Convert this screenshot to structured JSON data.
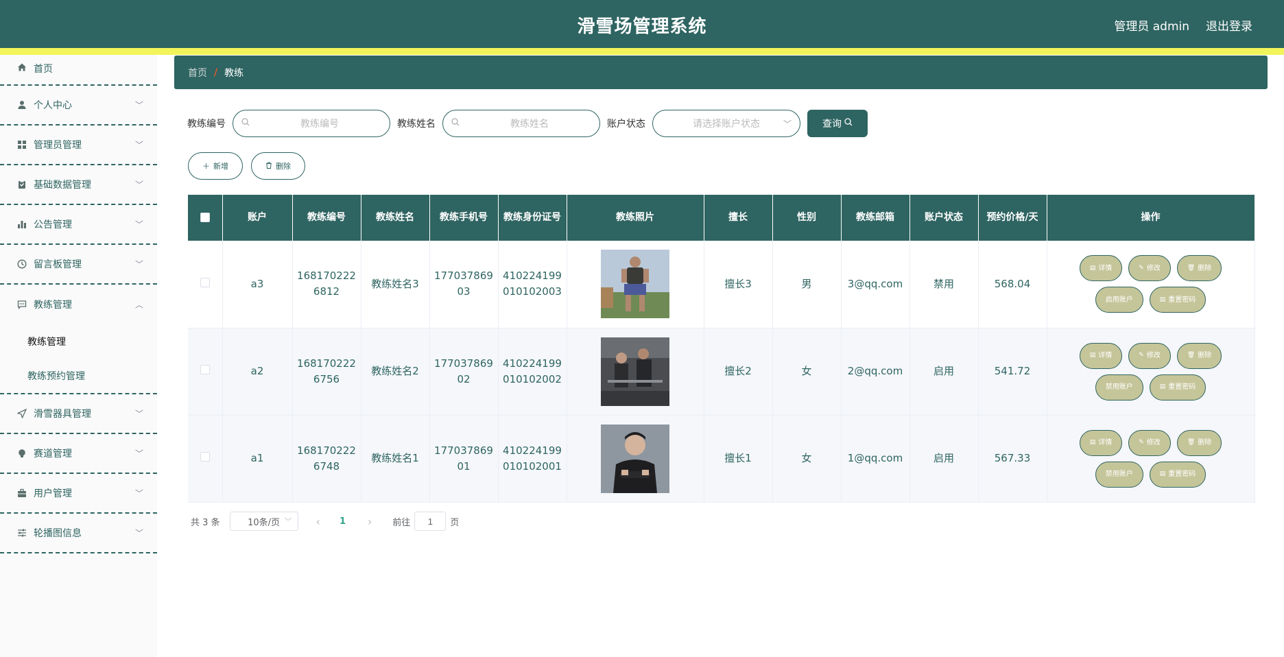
{
  "header": {
    "title": "滑雪场管理系统",
    "user_label": "管理员 admin",
    "logout_label": "退出登录"
  },
  "sidebar": {
    "items": [
      {
        "label": "首页",
        "icon": "home-icon"
      },
      {
        "label": "个人中心",
        "icon": "user-icon"
      },
      {
        "label": "管理员管理",
        "icon": "grid-icon"
      },
      {
        "label": "基础数据管理",
        "icon": "clipboard-icon"
      },
      {
        "label": "公告管理",
        "icon": "bar-chart-icon"
      },
      {
        "label": "留言板管理",
        "icon": "clock-icon"
      },
      {
        "label": "教练管理",
        "icon": "chat-icon"
      },
      {
        "label": "滑雪器具管理",
        "icon": "send-icon"
      },
      {
        "label": "赛道管理",
        "icon": "bulb-icon"
      },
      {
        "label": "用户管理",
        "icon": "briefcase-icon"
      },
      {
        "label": "轮播图信息",
        "icon": "sliders-icon"
      }
    ],
    "subitems": [
      {
        "label": "教练管理"
      },
      {
        "label": "教练预约管理"
      }
    ]
  },
  "breadcrumb": {
    "home": "首页",
    "separator": "/",
    "current": "教练"
  },
  "search": {
    "code_label": "教练编号",
    "code_placeholder": "教练编号",
    "name_label": "教练姓名",
    "name_placeholder": "教练姓名",
    "status_label": "账户状态",
    "status_placeholder": "请选择账户状态",
    "query_label": "查询"
  },
  "actions": {
    "add_label": "新增",
    "delete_label": "删除"
  },
  "table": {
    "headers": [
      "账户",
      "教练编号",
      "教练姓名",
      "教练手机号",
      "教练身份证号",
      "教练照片",
      "擅长",
      "性别",
      "教练邮箱",
      "账户状态",
      "预约价格/天",
      "操作"
    ],
    "rows": [
      {
        "account": "a3",
        "code": "1681702226812",
        "name": "教练姓名3",
        "phone": "17703786903",
        "id_card": "410224199010102003",
        "photo_colors": [
          "#b9c9d9",
          "#3a3a36",
          "#7a8a5a"
        ],
        "specialty": "擅长3",
        "gender": "男",
        "email": "3@qq.com",
        "status": "禁用",
        "price": "568.04",
        "toggle_label": "启用账户"
      },
      {
        "account": "a2",
        "code": "1681702226756",
        "name": "教练姓名2",
        "phone": "17703786902",
        "id_card": "410224199010102002",
        "photo_colors": [
          "#5d5f62",
          "#2c2c2e",
          "#8c8f93"
        ],
        "specialty": "擅长2",
        "gender": "女",
        "email": "2@qq.com",
        "status": "启用",
        "price": "541.72",
        "toggle_label": "禁用账户"
      },
      {
        "account": "a1",
        "code": "1681702226748",
        "name": "教练姓名1",
        "phone": "17703786901",
        "id_card": "410224199010102001",
        "photo_colors": [
          "#8e96a0",
          "#1e1e20",
          "#d4b49c"
        ],
        "specialty": "擅长1",
        "gender": "女",
        "email": "1@qq.com",
        "status": "启用",
        "price": "567.33",
        "toggle_label": "禁用账户"
      }
    ],
    "op_labels": {
      "detail": "详情",
      "edit": "修改",
      "delete": "删除",
      "reset": "重置密码"
    }
  },
  "pagination": {
    "total_text": "共 3 条",
    "page_size": "10条/页",
    "current_page": "1",
    "goto_label": "前往",
    "goto_value": "1",
    "page_suffix": "页"
  },
  "colors": {
    "primary": "#2e6461",
    "accent_stripe": "#f2f55a",
    "op_button": "#c5c59a",
    "active_page": "#2ea58a"
  }
}
